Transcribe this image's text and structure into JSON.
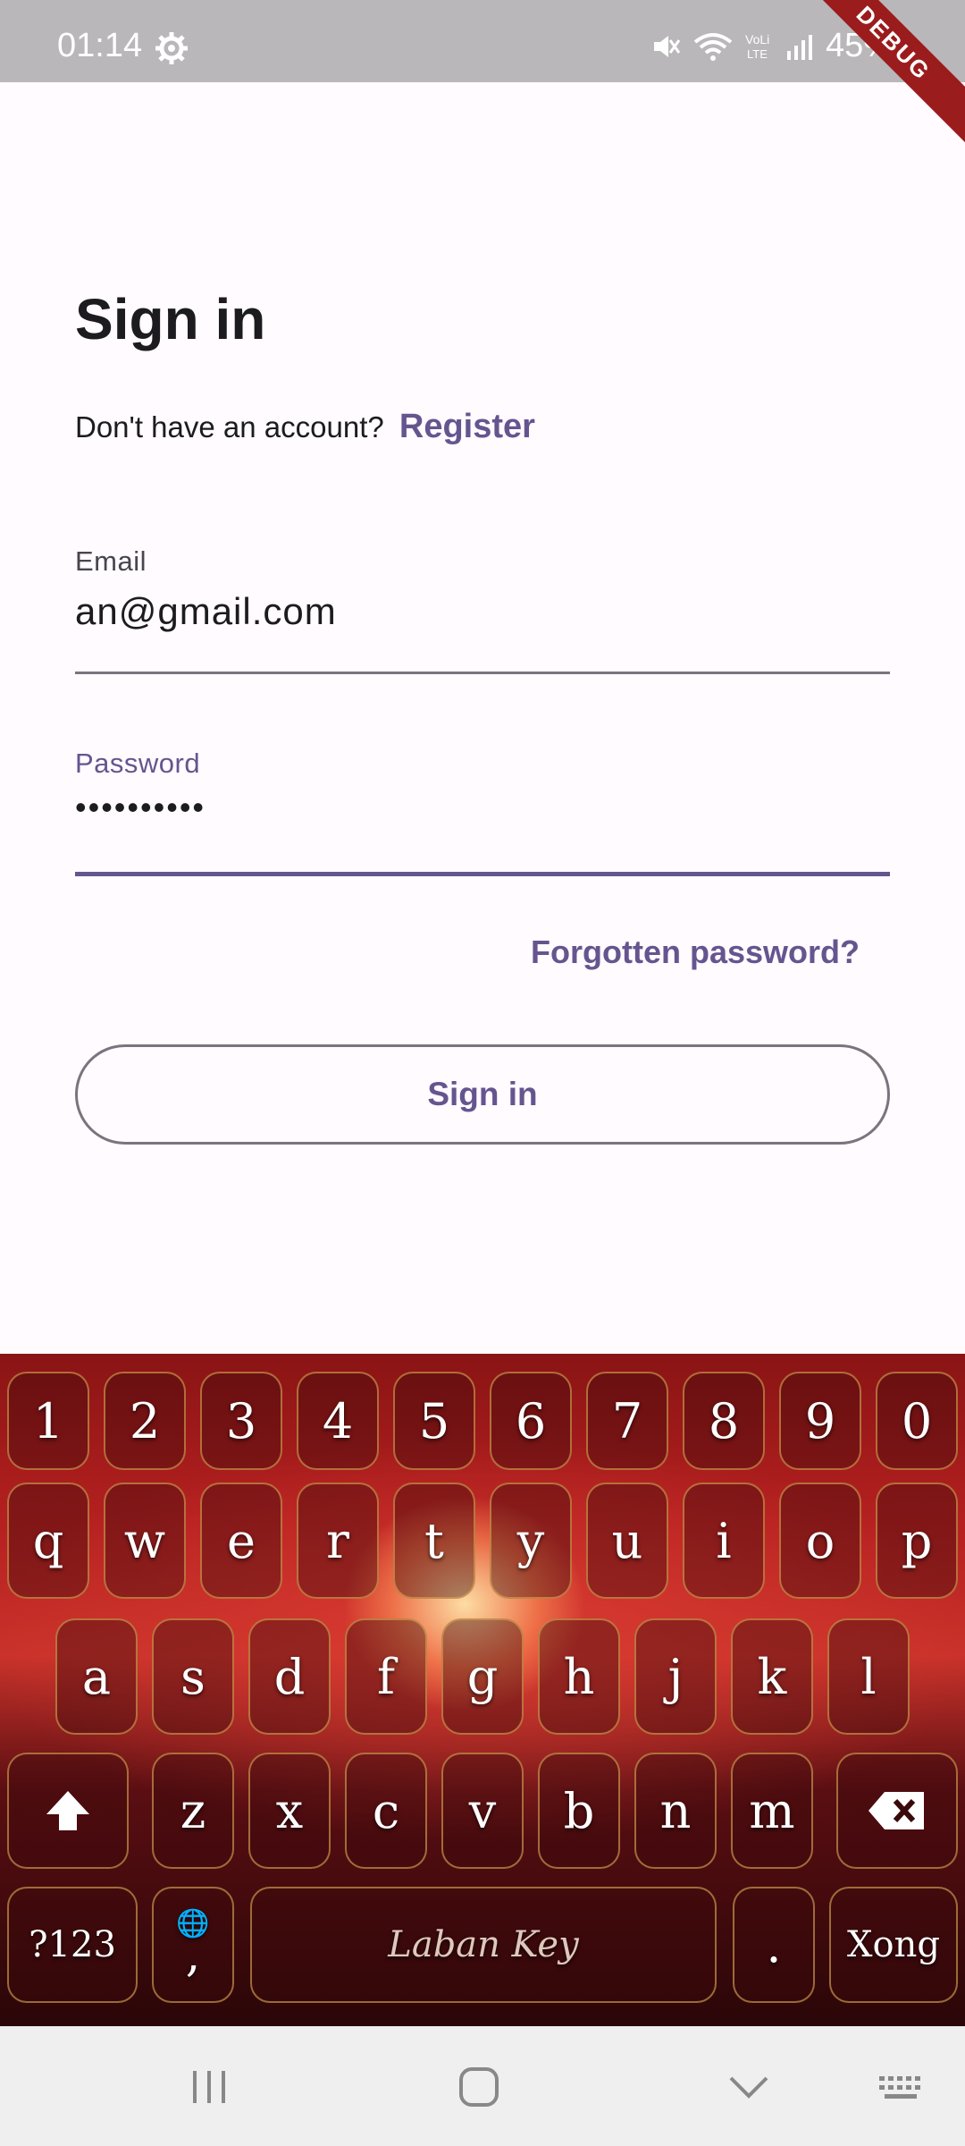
{
  "status_bar": {
    "time": "01:14",
    "battery": "45%",
    "icons": [
      "settings-icon",
      "mute-icon",
      "wifi-icon",
      "volte-icon",
      "signal-icon",
      "battery-icon"
    ]
  },
  "debug_ribbon": "DEBUG",
  "page": {
    "title": "Sign in",
    "register_prompt": "Don't have an account?",
    "register_link": "Register",
    "email_label": "Email",
    "email_value": "an@gmail.com",
    "password_label": "Password",
    "password_value": "••••••••••",
    "forgot_link": "Forgotten password?",
    "signin_button": "Sign in"
  },
  "colors": {
    "accent": "#65558f",
    "background": "#fffbff",
    "status_bar": "#b9b7b9"
  },
  "keyboard": {
    "row_numbers": [
      "1",
      "2",
      "3",
      "4",
      "5",
      "6",
      "7",
      "8",
      "9",
      "0"
    ],
    "row_top": [
      "q",
      "w",
      "e",
      "r",
      "t",
      "y",
      "u",
      "i",
      "o",
      "p"
    ],
    "row_middle": [
      "a",
      "s",
      "d",
      "f",
      "g",
      "h",
      "j",
      "k",
      "l"
    ],
    "row_bottom": [
      "z",
      "x",
      "c",
      "v",
      "b",
      "n",
      "m"
    ],
    "symbols_key": "?123",
    "comma_key": ",",
    "space_label": "Laban Key",
    "period_key": ".",
    "done_key": "Xong"
  }
}
